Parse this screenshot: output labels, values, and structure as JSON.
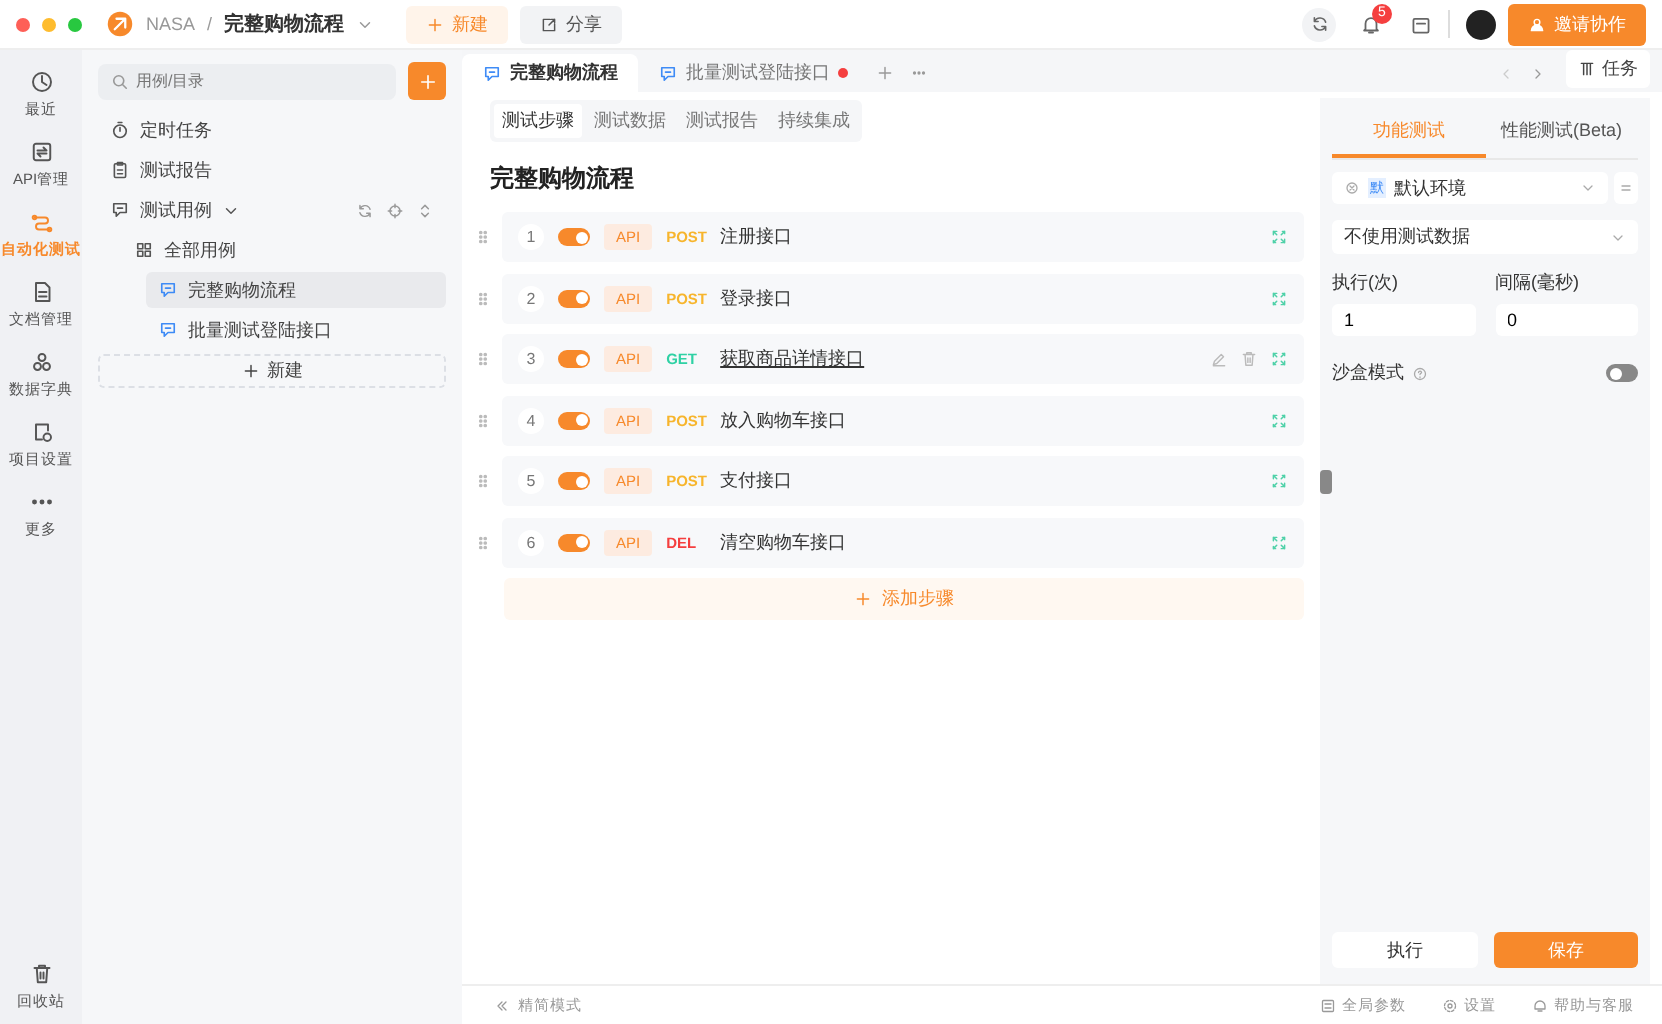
{
  "titlebar": {
    "project": "NASA",
    "separator": "/",
    "title": "完整购物流程",
    "new_button": "新建",
    "share_button": "分享",
    "notification_count": "5",
    "invite_button": "邀请协作"
  },
  "nav": {
    "items": [
      {
        "label": "最近",
        "kind": "clock",
        "selected": false
      },
      {
        "label": "API管理",
        "kind": "api",
        "selected": false
      },
      {
        "label": "自动化测试",
        "kind": "flow",
        "selected": true
      },
      {
        "label": "文档管理",
        "kind": "doc",
        "selected": false
      },
      {
        "label": "数据字典",
        "kind": "cubes",
        "selected": false
      },
      {
        "label": "项目设置",
        "kind": "settings",
        "selected": false
      },
      {
        "label": "更多",
        "kind": "more",
        "selected": false
      }
    ],
    "bottom_item": {
      "label": "回收站",
      "kind": "trash",
      "selected": false
    }
  },
  "sidebar": {
    "search_placeholder": "用例/目录",
    "items": [
      {
        "label": "定时任务",
        "kind": "timer"
      },
      {
        "label": "测试报告",
        "kind": "report"
      },
      {
        "label": "测试用例",
        "kind": "case",
        "expanded": true,
        "children": [
          {
            "label": "全部用例",
            "kind": "folder",
            "children": [
              {
                "label": "完整购物流程",
                "kind": "case-file",
                "selected": true
              },
              {
                "label": "批量测试登陆接口",
                "kind": "case-file",
                "selected": false
              }
            ]
          }
        ]
      }
    ],
    "new_button": "新建"
  },
  "tabs": [
    {
      "label": "完整购物流程",
      "selected": true,
      "unsaved": false
    },
    {
      "label": "批量测试登陆接口",
      "selected": false,
      "unsaved": true
    }
  ],
  "task_button": "任务",
  "subtabs": [
    {
      "label": "测试步骤",
      "selected": true
    },
    {
      "label": "测试数据",
      "selected": false
    },
    {
      "label": "测试报告",
      "selected": false
    },
    {
      "label": "持续集成",
      "selected": false
    }
  ],
  "heading": "完整购物流程",
  "steps": [
    {
      "number": "1",
      "enabled": true,
      "type": "API",
      "method": "POST",
      "color": "#f7b52c",
      "name": "注册接口",
      "hovered": false
    },
    {
      "number": "2",
      "enabled": true,
      "type": "API",
      "method": "POST",
      "color": "#f7b52c",
      "name": "登录接口",
      "hovered": false
    },
    {
      "number": "3",
      "enabled": true,
      "type": "API",
      "method": "GET",
      "color": "#2fd1a4",
      "name": "获取商品详情接口",
      "hovered": true
    },
    {
      "number": "4",
      "enabled": true,
      "type": "API",
      "method": "POST",
      "color": "#f7b52c",
      "name": "放入购物车接口",
      "hovered": false
    },
    {
      "number": "5",
      "enabled": true,
      "type": "API",
      "method": "POST",
      "color": "#f7b52c",
      "name": "支付接口",
      "hovered": false
    },
    {
      "number": "6",
      "enabled": true,
      "type": "API",
      "method": "DEL",
      "color": "#f53f3f",
      "name": "清空购物车接口",
      "hovered": false
    }
  ],
  "add_step": "添加步骤",
  "panel": {
    "tabs": [
      {
        "label": "功能测试",
        "selected": true
      },
      {
        "label": "性能测试(Beta)",
        "selected": false
      }
    ],
    "environment": {
      "badge": "默",
      "value": "默认环境"
    },
    "test_data": "不使用测试数据",
    "runs": {
      "label": "执行(次)",
      "value": "1"
    },
    "interval": {
      "label": "间隔(毫秒)",
      "value": "0"
    },
    "sandbox": {
      "label": "沙盒模式",
      "on": false
    },
    "run_button": "执行",
    "save_button": "保存"
  },
  "footer": {
    "compact_mode": "精简模式",
    "links": [
      {
        "label": "全局参数",
        "kind": "params"
      },
      {
        "label": "设置",
        "kind": "gear"
      },
      {
        "label": "帮助与客服",
        "kind": "help"
      }
    ]
  }
}
